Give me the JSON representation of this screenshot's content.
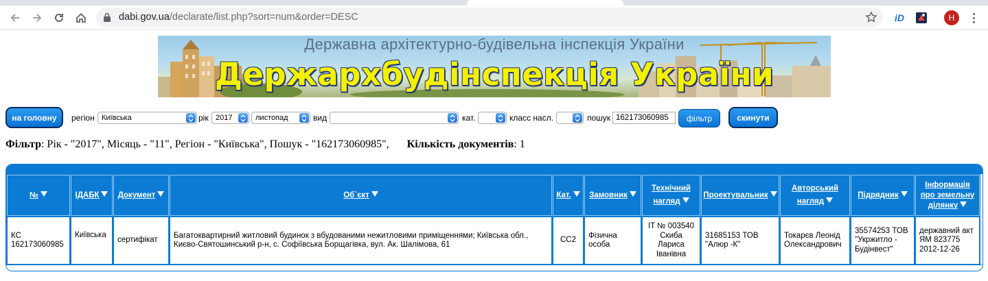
{
  "browser": {
    "url_host": "dabi.gov.ua",
    "url_path": "/declarate/list.php?sort=num&order=DESC",
    "ext1_label": "iD",
    "avatar_letter": "H"
  },
  "banner": {
    "subtitle": "Державна архітектурно-будівельна інспекція України",
    "title": "Держархбудінспекція України"
  },
  "filters": {
    "home_button": "на головну",
    "region_label": "регіон",
    "region_value": "Київська",
    "year_label": "рік",
    "year_value": "2017",
    "month_value": "листопад",
    "type_label": "вид",
    "type_value": "",
    "cat_label": "кат.",
    "cat_value": "",
    "class_label": "класс насл.",
    "class_value": "",
    "search_label": "пошук",
    "search_value": "162173060985",
    "filter_button": "фільтр",
    "reset_button": "скинути"
  },
  "summary": {
    "filter_label": "Фільтр",
    "filter_text": ": Рік - \"2017\", Місяць - \"11\", Регіон - \"Київська\", Пошук - \"162173060985\",",
    "count_label": "Кількість документів",
    "count_value": ": 1"
  },
  "table": {
    "headers": [
      "№",
      "ІДАБК",
      "Документ",
      "Об`єкт",
      "Кат.",
      "Замовник",
      "Технічний нагляд",
      "Проектувальник",
      "Авторський нагляд",
      "Підрядник",
      "Інформація про земельну ділянку"
    ],
    "row": {
      "num": "КС 162173060985",
      "idabk": "Київська",
      "document": "сертифікат",
      "object": "Багатоквартирний житловий будинок з вбудованими нежитловими приміщеннями; Київська обл., Києво-Святошинський р-н, с. Софіївська Борщагівка, вул. Ак. Шалімова, 61",
      "category": "СС2",
      "customer": "Фізична особа",
      "tech_supervision": "IT № 003540 Скиба Лариса Іванівна",
      "designer": "31685153 ТОВ \"Алюр -К\"",
      "author_supervision": "Токарєв Леонід Олександрович",
      "contractor": "35574253 ТОВ \"Укржитло - Будінвест\"",
      "land_info": "державний акт ЯМ 823775 2012-12-26"
    }
  },
  "colors": {
    "table_blue": "#0b7bd4",
    "button_blue": "#1686e6",
    "banner_title": "#f3f000"
  }
}
